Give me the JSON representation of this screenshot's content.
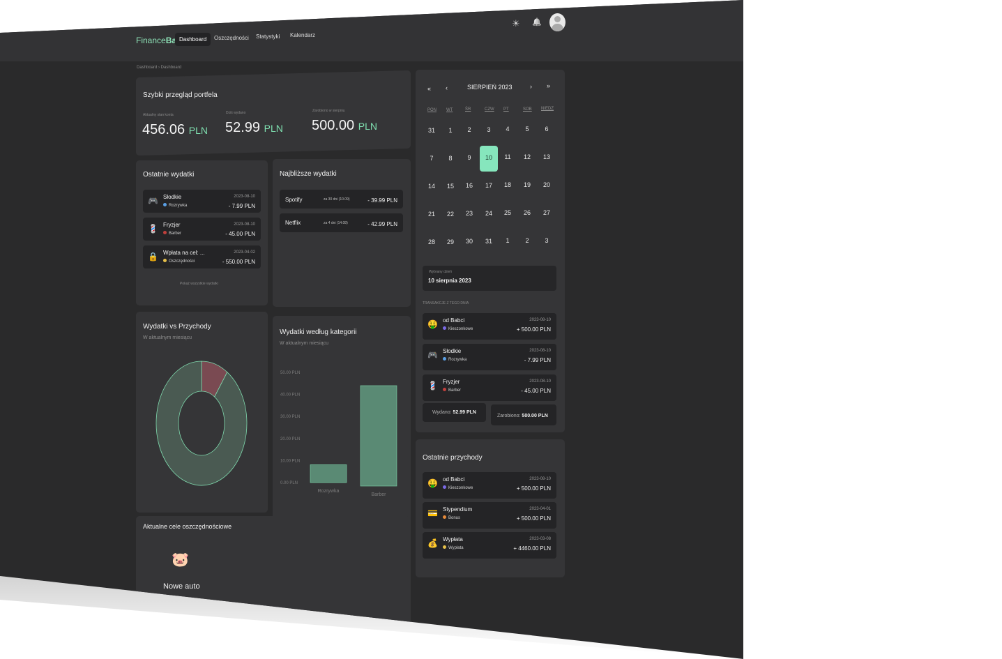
{
  "brand": {
    "prefix": "Finance",
    "suffix": "Bay"
  },
  "nav": [
    "Dashboard",
    "Oszczędności",
    "Statystyki",
    "Kalendarz"
  ],
  "topbar": {
    "theme_icon": "☀",
    "bell_icon": "🔔"
  },
  "breadcrumb": "Dashboard  ›  Dashboard",
  "portfolio": {
    "title": "Szybki przegląd portfela",
    "stats": [
      {
        "label": "Aktualny stan konta",
        "value": "456.06",
        "unit": "PLN"
      },
      {
        "label": "Dziś wydano",
        "value": "52.99",
        "unit": "PLN"
      },
      {
        "label": "Zarobiono w sierpniu",
        "value": "500.00",
        "unit": "PLN"
      }
    ]
  },
  "recent_expenses": {
    "title": "Ostatnie wydatki",
    "items": [
      {
        "icon": "🎮",
        "name": "Słodkie",
        "category": "Rozrywka",
        "cat_color": "#5aa0e6",
        "date": "2023-08-10",
        "amount": "- 7.99 PLN"
      },
      {
        "icon": "💈",
        "name": "Fryzjer",
        "category": "Barber",
        "cat_color": "#c0403c",
        "date": "2023-08-10",
        "amount": "- 45.00 PLN"
      },
      {
        "icon": "🔒",
        "name": "Wpłata na cel: ...",
        "category": "Oszczędności",
        "cat_color": "#e6c04a",
        "date": "2023-04-02",
        "amount": "- 550.00 PLN"
      }
    ],
    "show_all": "Pokaż wszystkie wydatki"
  },
  "upcoming": {
    "title": "Najbliższe wydatki",
    "items": [
      {
        "name": "Spotify",
        "when": "za 30 dni (10.09)",
        "amount": "- 39.99 PLN"
      },
      {
        "name": "Netflix",
        "when": "za 4 dni (14.08)",
        "amount": "- 42.99 PLN"
      }
    ]
  },
  "income_vs_expense": {
    "title": "Wydatki vs Przychody",
    "subtitle": "W aktualnym miesiącu"
  },
  "by_category": {
    "title": "Wydatki według kategorii",
    "subtitle": "W aktualnym miesiącu"
  },
  "chart_data": [
    {
      "type": "pie",
      "title": "Wydatki vs Przychody",
      "subtitle": "W aktualnym miesiącu",
      "categories": [
        "Wydatki",
        "Przychody"
      ],
      "values": [
        52.99,
        500.0
      ],
      "colors": [
        "#7a4a52",
        "#4a5a52"
      ]
    },
    {
      "type": "bar",
      "title": "Wydatki według kategorii",
      "subtitle": "W aktualnym miesiącu",
      "categories": [
        "Rozrywka",
        "Barber"
      ],
      "values": [
        7.99,
        45.0
      ],
      "yticks": [
        "0.00 PLN",
        "10.00 PLN",
        "20.00 PLN",
        "30.00 PLN",
        "40.00 PLN",
        "50.00 PLN"
      ],
      "ylim": [
        0,
        50
      ],
      "color": "#5a8a74"
    }
  ],
  "savings": {
    "title": "Aktualne cele oszczędnościowe",
    "goal_name": "Nowe auto"
  },
  "calendar": {
    "month": "SIERPIEŃ 2023",
    "nav": [
      "«",
      "‹",
      "›",
      "»"
    ],
    "weekdays": [
      "PON",
      "WT",
      "ŚR",
      "CZW",
      "PT",
      "SOB",
      "NIEDZ"
    ],
    "weeks": [
      [
        "31",
        "1",
        "2",
        "3",
        "4",
        "5",
        "6"
      ],
      [
        "7",
        "8",
        "9",
        "10",
        "11",
        "12",
        "13"
      ],
      [
        "14",
        "15",
        "16",
        "17",
        "18",
        "19",
        "20"
      ],
      [
        "21",
        "22",
        "23",
        "24",
        "25",
        "26",
        "27"
      ],
      [
        "28",
        "29",
        "30",
        "31",
        "1",
        "2",
        "3"
      ]
    ],
    "selected_label": "Wybrany dzień",
    "selected_value": "10 sierpnia 2023",
    "transactions_label": "TRANSAKCJE Z TEGO DNIA",
    "transactions": [
      {
        "icon": "🤑",
        "name": "od Babci",
        "category": "Kieszonkowe",
        "cat_color": "#7a6ae6",
        "date": "2023-08-10",
        "amount": "+ 500.00 PLN"
      },
      {
        "icon": "🎮",
        "name": "Słodkie",
        "category": "Rozrywka",
        "cat_color": "#5aa0e6",
        "date": "2023-08-10",
        "amount": "- 7.99 PLN"
      },
      {
        "icon": "💈",
        "name": "Fryzjer",
        "category": "Barber",
        "cat_color": "#c0403c",
        "date": "2023-08-10",
        "amount": "- 45.00 PLN"
      }
    ],
    "spent_label": "Wydano:",
    "spent_value": "52.99 PLN",
    "earned_label": "Zarobiono:",
    "earned_value": "500.00 PLN"
  },
  "recent_income": {
    "title": "Ostatnie przychody",
    "items": [
      {
        "icon": "🤑",
        "name": "od Babci",
        "category": "Kieszonkowe",
        "cat_color": "#7a6ae6",
        "date": "2023-08-10",
        "amount": "+ 500.00 PLN"
      },
      {
        "icon": "💳",
        "name": "Stypendium",
        "category": "Bonus",
        "cat_color": "#e68a3a",
        "date": "2023-04-01",
        "amount": "+ 500.00 PLN"
      },
      {
        "icon": "💰",
        "name": "Wypłata",
        "category": "Wypłata",
        "cat_color": "#e6c04a",
        "date": "2023-03-08",
        "amount": "+ 4460.00 PLN"
      }
    ]
  }
}
